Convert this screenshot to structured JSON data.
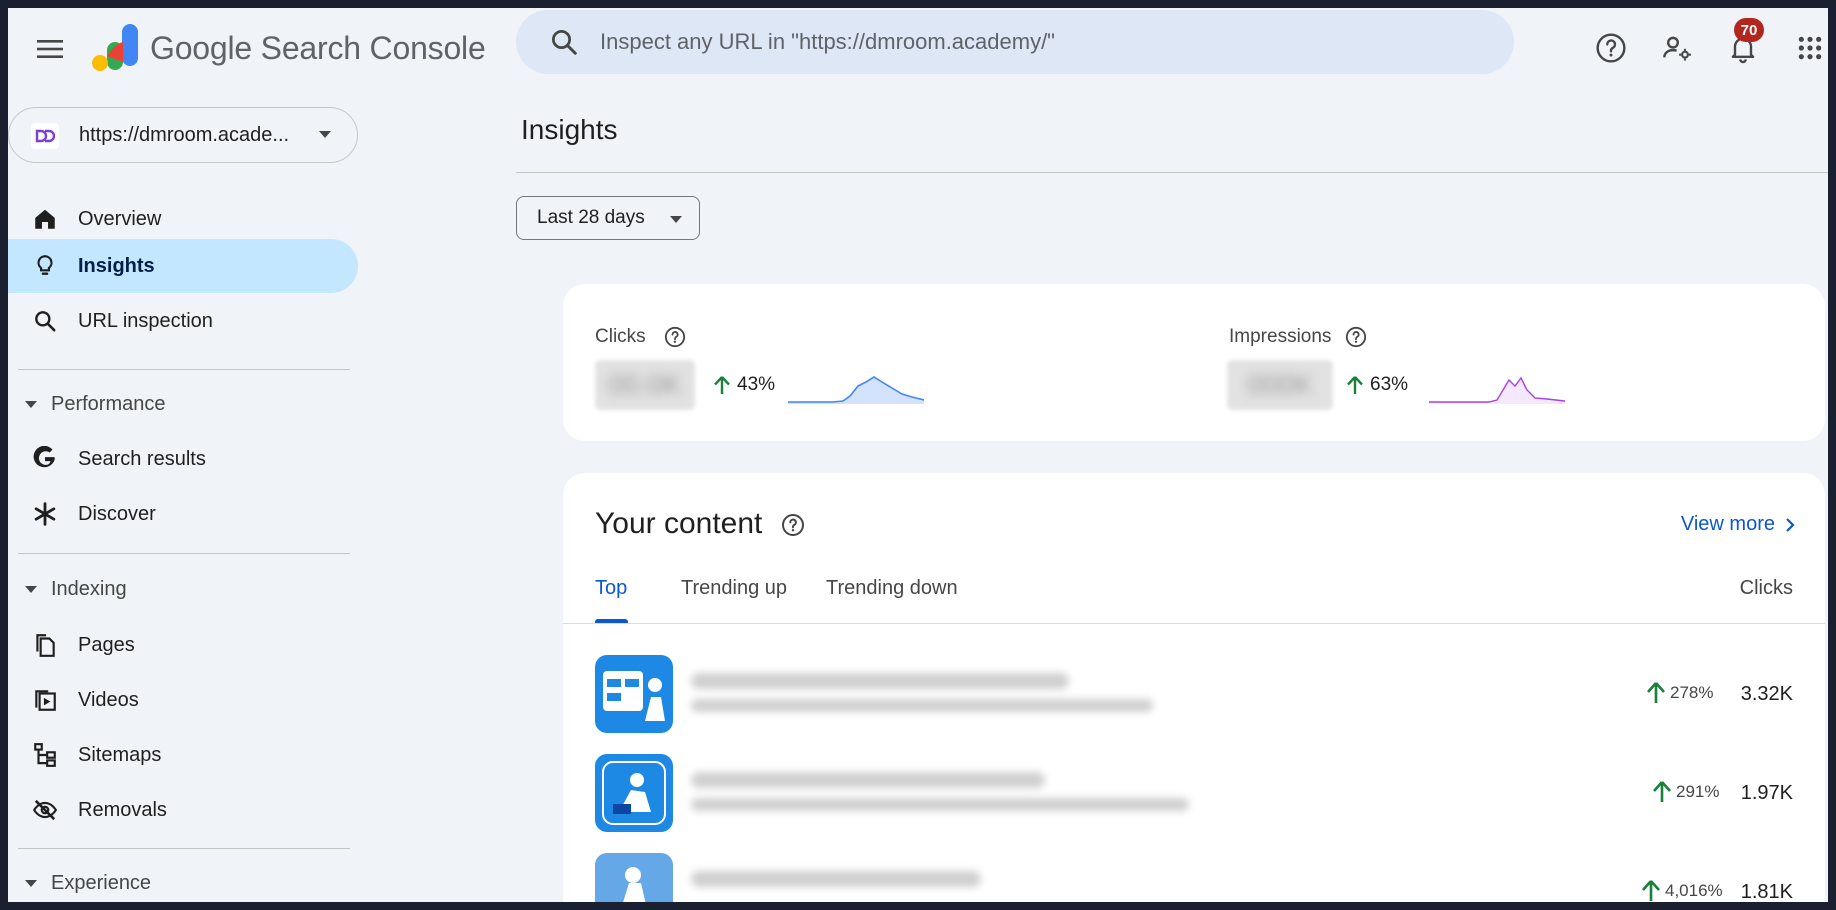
{
  "app": {
    "brand": "Google Search Console"
  },
  "header": {
    "search_placeholder": "Inspect any URL in \"https://dmroom.academy/\"",
    "notification_count": "70"
  },
  "sidebar": {
    "property": "https://dmroom.acade...",
    "nav_top": [
      {
        "label": "Overview",
        "icon": "home-icon"
      },
      {
        "label": "Insights",
        "icon": "lightbulb-icon",
        "active": true
      },
      {
        "label": "URL inspection",
        "icon": "search-icon"
      }
    ],
    "sections": [
      {
        "label": "Performance",
        "items": [
          {
            "label": "Search results",
            "icon": "google-g-icon"
          },
          {
            "label": "Discover",
            "icon": "asterisk-icon"
          }
        ]
      },
      {
        "label": "Indexing",
        "items": [
          {
            "label": "Pages",
            "icon": "pages-icon"
          },
          {
            "label": "Videos",
            "icon": "video-icon"
          },
          {
            "label": "Sitemaps",
            "icon": "sitemap-icon"
          },
          {
            "label": "Removals",
            "icon": "eye-off-icon"
          }
        ]
      },
      {
        "label": "Experience",
        "items": []
      }
    ]
  },
  "main": {
    "title": "Insights",
    "date_range": "Last 28 days",
    "metrics": {
      "clicks": {
        "label": "Clicks",
        "change": "43%",
        "color": "#4285f4"
      },
      "impressions": {
        "label": "Impressions",
        "change": "63%",
        "color": "#a142f4"
      }
    },
    "content": {
      "title": "Your content",
      "view_more": "View more",
      "tabs": [
        "Top",
        "Trending up",
        "Trending down"
      ],
      "active_tab": "Top",
      "column_header": "Clicks",
      "rows": [
        {
          "change": "278%",
          "clicks": "3.32K"
        },
        {
          "change": "291%",
          "clicks": "1.97K"
        },
        {
          "change": "4,016%",
          "clicks": "1.81K"
        }
      ]
    }
  },
  "colors": {
    "accent": "#0b57d0",
    "active_nav": "#c2e7ff",
    "positive": "#188038",
    "badge": "#b3261e"
  }
}
